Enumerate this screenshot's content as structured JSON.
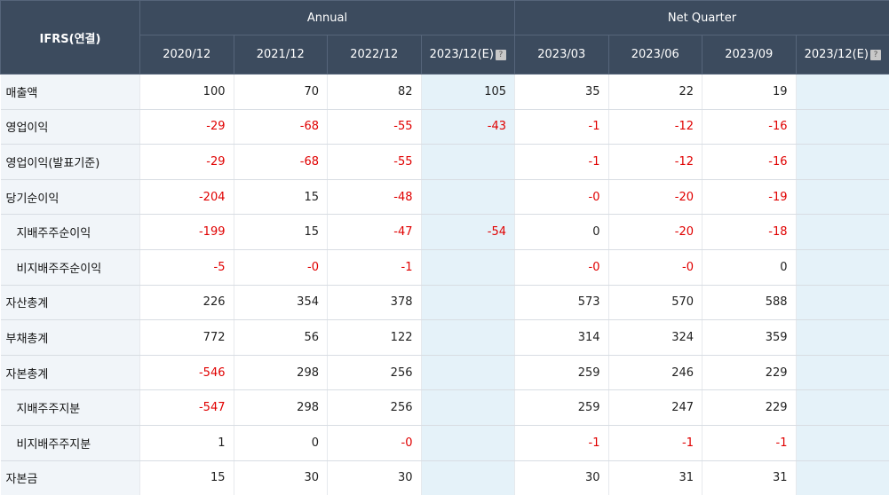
{
  "table": {
    "title": "IFRS(연결)",
    "group_annual": "Annual",
    "group_quarter": "Net Quarter",
    "columns": [
      "2020/12",
      "2021/12",
      "2022/12",
      "2023/12(E)",
      "2023/03",
      "2023/06",
      "2023/09",
      "2023/12(E)"
    ],
    "estimate_icon": "question-mark-icon",
    "neg_color": "#e00000",
    "estimate_bg": "#e5f2f9",
    "header_bg": "#3c4b5e",
    "rows": [
      {
        "label": "매출액",
        "sub": false,
        "values": [
          "100",
          "70",
          "82",
          "105",
          "35",
          "22",
          "19",
          ""
        ]
      },
      {
        "label": "영업이익",
        "sub": false,
        "values": [
          "-29",
          "-68",
          "-55",
          "-43",
          "-1",
          "-12",
          "-16",
          ""
        ]
      },
      {
        "label": "영업이익(발표기준)",
        "sub": false,
        "values": [
          "-29",
          "-68",
          "-55",
          "",
          "-1",
          "-12",
          "-16",
          ""
        ]
      },
      {
        "label": "당기순이익",
        "sub": false,
        "values": [
          "-204",
          "15",
          "-48",
          "",
          "-0",
          "-20",
          "-19",
          ""
        ]
      },
      {
        "label": "지배주주순이익",
        "sub": true,
        "values": [
          "-199",
          "15",
          "-47",
          "-54",
          "0",
          "-20",
          "-18",
          ""
        ]
      },
      {
        "label": "비지배주주순이익",
        "sub": true,
        "values": [
          "-5",
          "-0",
          "-1",
          "",
          "-0",
          "-0",
          "0",
          ""
        ]
      },
      {
        "label": "자산총계",
        "sub": false,
        "values": [
          "226",
          "354",
          "378",
          "",
          "573",
          "570",
          "588",
          ""
        ]
      },
      {
        "label": "부채총계",
        "sub": false,
        "values": [
          "772",
          "56",
          "122",
          "",
          "314",
          "324",
          "359",
          ""
        ]
      },
      {
        "label": "자본총계",
        "sub": false,
        "values": [
          "-546",
          "298",
          "256",
          "",
          "259",
          "246",
          "229",
          ""
        ]
      },
      {
        "label": "지배주주지분",
        "sub": true,
        "values": [
          "-547",
          "298",
          "256",
          "",
          "259",
          "247",
          "229",
          ""
        ]
      },
      {
        "label": "비지배주주지분",
        "sub": true,
        "values": [
          "1",
          "0",
          "-0",
          "",
          "-1",
          "-1",
          "-1",
          ""
        ]
      },
      {
        "label": "자본금",
        "sub": false,
        "values": [
          "15",
          "30",
          "30",
          "",
          "30",
          "31",
          "31",
          ""
        ]
      }
    ]
  }
}
